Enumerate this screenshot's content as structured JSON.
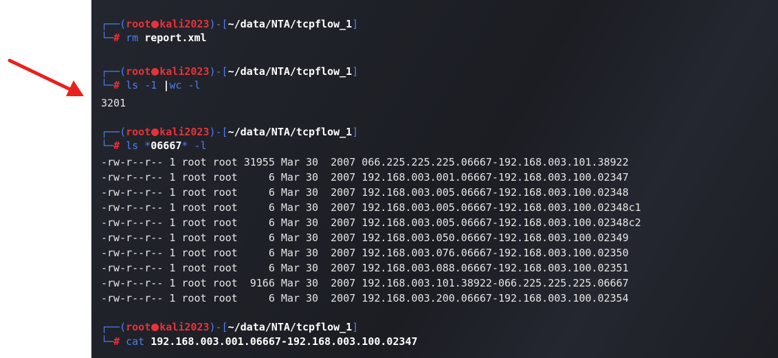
{
  "prompt": {
    "user": "root",
    "host": "kali2023",
    "path": "~/data/NTA/tcpflow_1"
  },
  "cmd1": {
    "command": "rm",
    "arg": "report.xml"
  },
  "cmd2": {
    "command": "ls",
    "arg": "-1",
    "pipe": "|",
    "command2": "wc",
    "arg2": "-l",
    "output": "3201"
  },
  "cmd3": {
    "command": "ls",
    "glob_pre": "*",
    "glob_mid": "06667",
    "glob_post": "*",
    "arg": "-l"
  },
  "listing": [
    "-rw-r--r-- 1 root root 31955 Mar 30  2007 066.225.225.225.06667-192.168.003.101.38922",
    "-rw-r--r-- 1 root root     6 Mar 30  2007 192.168.003.001.06667-192.168.003.100.02347",
    "-rw-r--r-- 1 root root     6 Mar 30  2007 192.168.003.005.06667-192.168.003.100.02348",
    "-rw-r--r-- 1 root root     6 Mar 30  2007 192.168.003.005.06667-192.168.003.100.02348c1",
    "-rw-r--r-- 1 root root     6 Mar 30  2007 192.168.003.005.06667-192.168.003.100.02348c2",
    "-rw-r--r-- 1 root root     6 Mar 30  2007 192.168.003.050.06667-192.168.003.100.02349",
    "-rw-r--r-- 1 root root     6 Mar 30  2007 192.168.003.076.06667-192.168.003.100.02350",
    "-rw-r--r-- 1 root root     6 Mar 30  2007 192.168.003.088.06667-192.168.003.100.02351",
    "-rw-r--r-- 1 root root  9166 Mar 30  2007 192.168.003.101.38922-066.225.225.225.06667",
    "-rw-r--r-- 1 root root     6 Mar 30  2007 192.168.003.200.06667-192.168.003.100.02354"
  ],
  "cmd4": {
    "command": "cat",
    "arg": "192.168.003.001.06667-192.168.003.100.02347"
  },
  "colors": {
    "accent_blue": "#4d7df1",
    "prompt_red": "#e7323a",
    "arrow_red": "#e8211d",
    "background": "#1f2127"
  }
}
